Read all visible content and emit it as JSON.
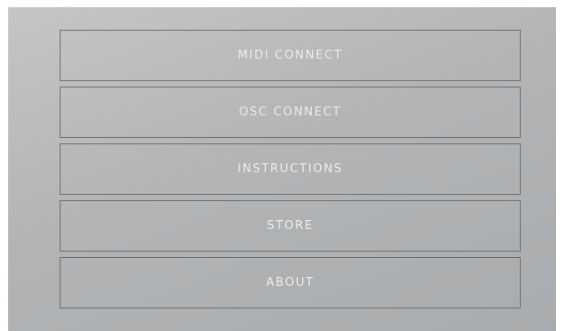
{
  "menu": {
    "items": [
      {
        "label": "MIDI CONNECT"
      },
      {
        "label": "OSC CONNECT"
      },
      {
        "label": "INSTRUCTIONS"
      },
      {
        "label": "STORE"
      },
      {
        "label": "ABOUT"
      }
    ]
  }
}
